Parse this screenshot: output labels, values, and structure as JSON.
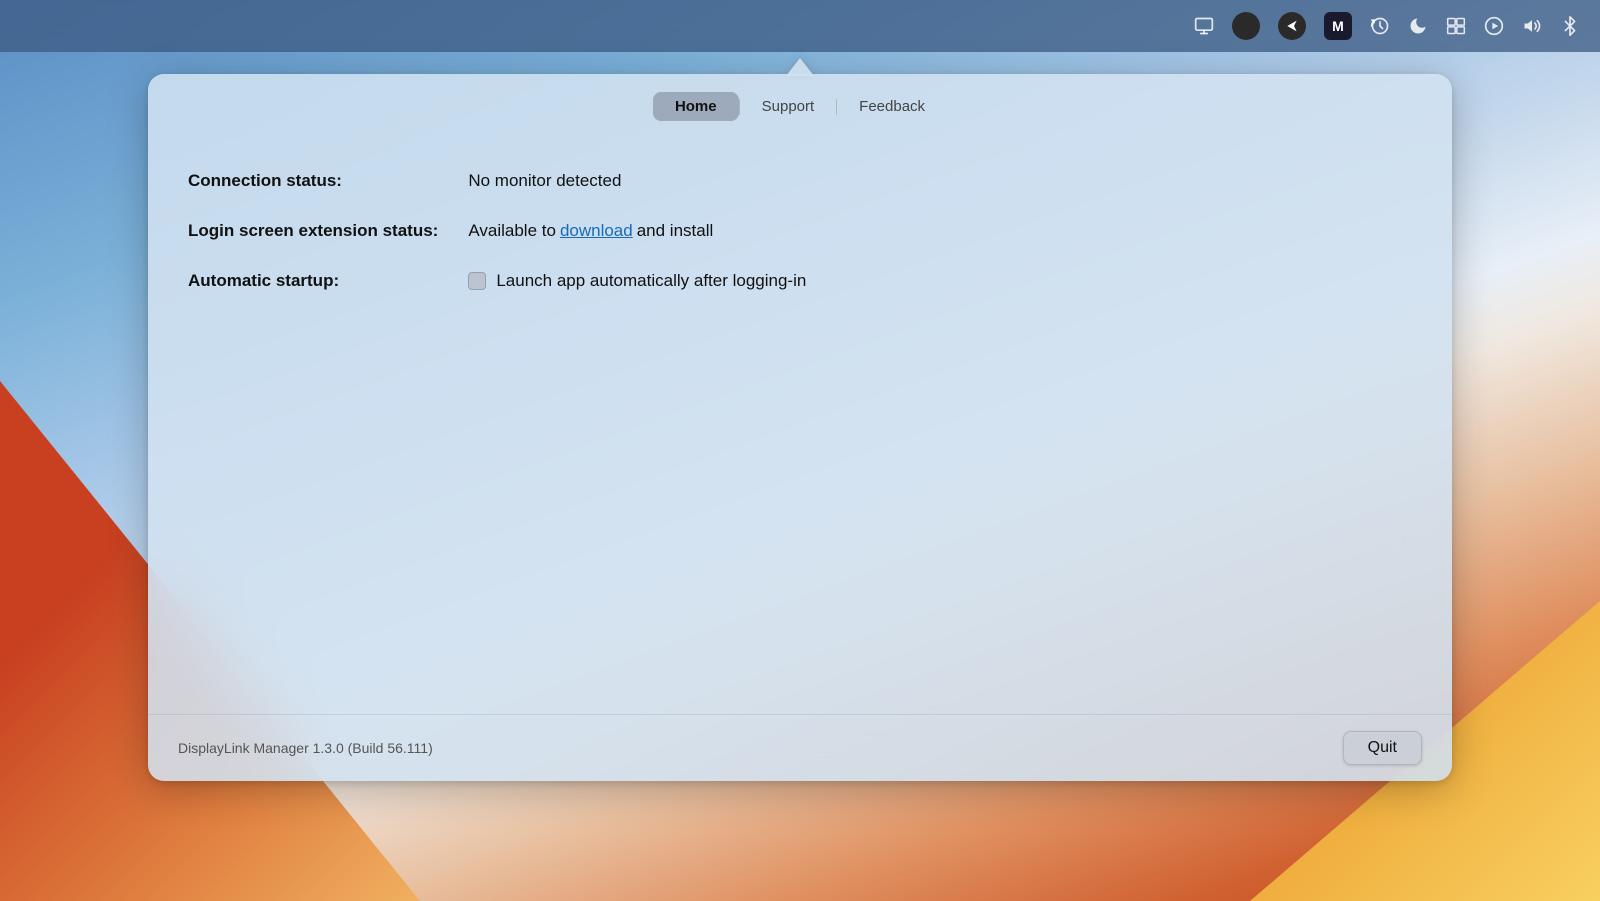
{
  "menubar": {
    "icons": [
      {
        "name": "display-icon",
        "unicode": "🖥"
      },
      {
        "name": "user-icon",
        "unicode": "●"
      },
      {
        "name": "navigation-icon",
        "unicode": "◀"
      },
      {
        "name": "malware-icon",
        "unicode": "M"
      },
      {
        "name": "time-machine-icon",
        "unicode": "⏱"
      },
      {
        "name": "night-shift-icon",
        "unicode": "☾"
      },
      {
        "name": "screens-icon",
        "unicode": "▣"
      },
      {
        "name": "play-icon",
        "unicode": "▶"
      },
      {
        "name": "volume-icon",
        "unicode": "🔊"
      },
      {
        "name": "bluetooth-icon",
        "unicode": "✦"
      }
    ]
  },
  "tabs": [
    {
      "id": "home",
      "label": "Home",
      "active": true
    },
    {
      "id": "support",
      "label": "Support",
      "active": false
    },
    {
      "id": "feedback",
      "label": "Feedback",
      "active": false
    }
  ],
  "content": {
    "connection_status_label": "Connection status:",
    "connection_status_value": "No monitor detected",
    "login_screen_label": "Login screen extension status:",
    "login_screen_value_prefix": "Available to ",
    "login_screen_link": "download",
    "login_screen_value_suffix": " and install",
    "automatic_startup_label": "Automatic startup:",
    "automatic_startup_checkbox_label": "Launch app automatically after logging-in"
  },
  "footer": {
    "version_text": "DisplayLink Manager 1.3.0 (Build 56.111)",
    "quit_button_label": "Quit"
  }
}
